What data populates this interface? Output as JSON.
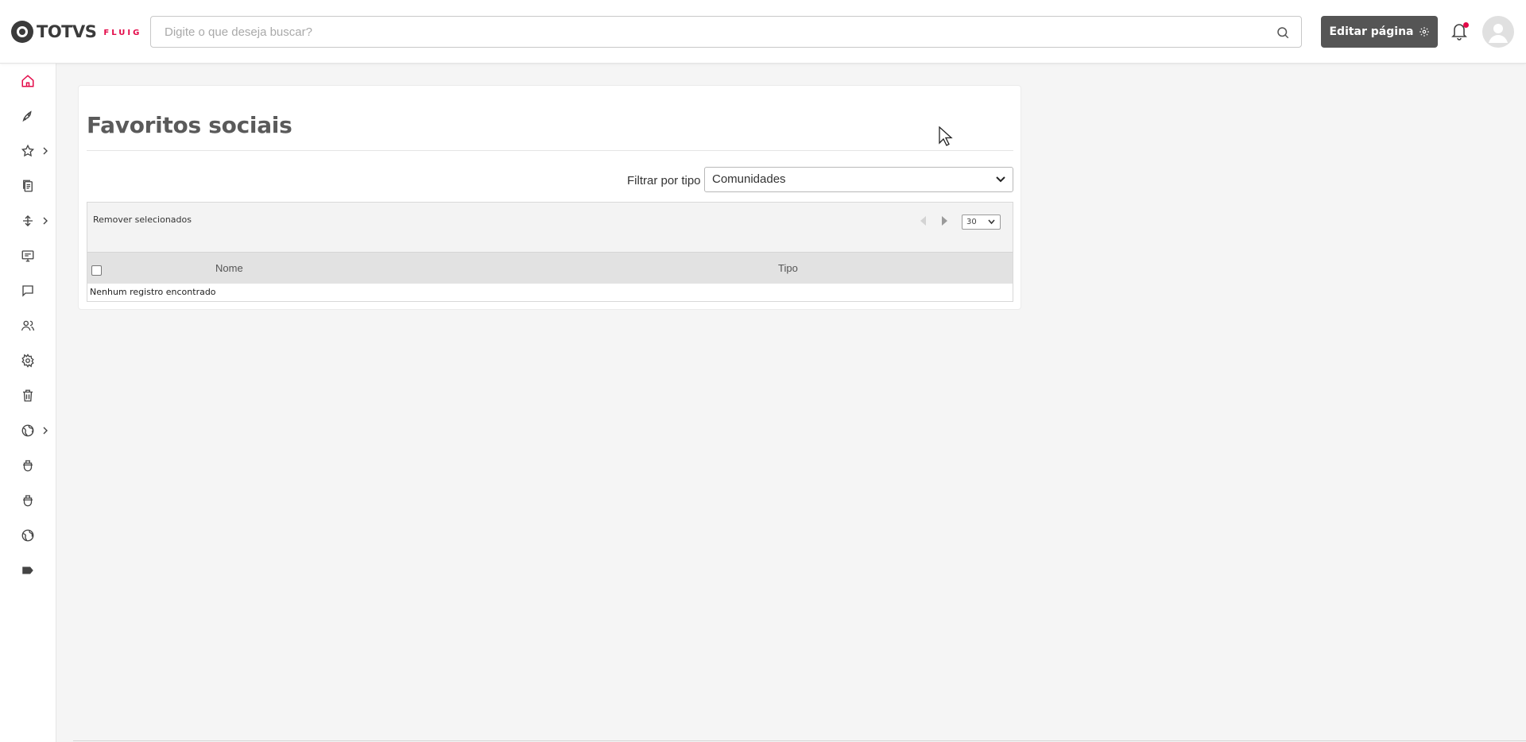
{
  "brand": {
    "logo_text": "TOTVS",
    "product_text": "FLUIG",
    "product_color": "#e30a49"
  },
  "header": {
    "search_placeholder": "Digite o que deseja buscar?",
    "edit_button_label": "Editar página",
    "notification_badge_color": "#e30a49"
  },
  "sidebar": {
    "items": [
      {
        "icon": "home-icon",
        "active": true
      },
      {
        "icon": "rocket-icon"
      },
      {
        "icon": "star-icon",
        "has_submenu": true
      },
      {
        "icon": "documents-icon"
      },
      {
        "icon": "workflow-icon",
        "has_submenu": true
      },
      {
        "icon": "monitor-icon"
      },
      {
        "icon": "chat-icon"
      },
      {
        "icon": "users-icon"
      },
      {
        "icon": "settings-icon"
      },
      {
        "icon": "trash-icon"
      },
      {
        "icon": "globe-icon",
        "has_submenu": true
      },
      {
        "icon": "cup-icon"
      },
      {
        "icon": "cup-icon"
      },
      {
        "icon": "globe-icon"
      },
      {
        "icon": "tag-icon"
      }
    ],
    "active_color": "#e30a49"
  },
  "main": {
    "title": "Favoritos sociais",
    "filter": {
      "label": "Filtrar por tipo",
      "selected": "Comunidades"
    },
    "grid": {
      "remove_selected_label": "Remover selecionados",
      "page_size": "30",
      "columns": [
        "Nome",
        "Tipo"
      ],
      "empty_message": "Nenhum registro encontrado"
    }
  }
}
